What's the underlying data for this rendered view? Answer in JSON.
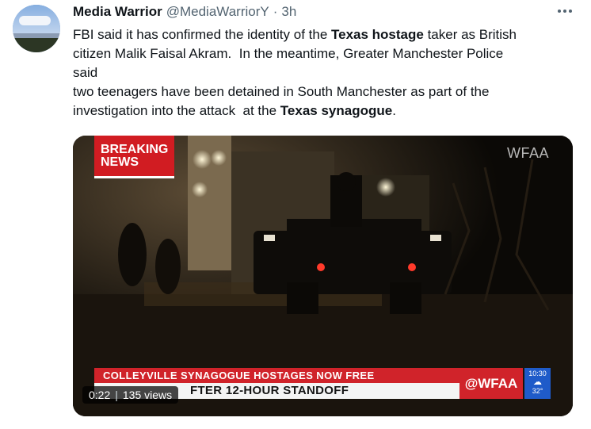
{
  "author": {
    "display_name": "Media Warrior",
    "handle": "@MediaWarriorY",
    "separator": "·",
    "timestamp": "3h"
  },
  "tweet": {
    "line1_a": "FBI said it has confirmed the identity of the ",
    "line1_bold": "Texas hostage",
    "line1_b": " taker as British",
    "line2": "citizen Malik Faisal Akram.  In the meantime, Greater Manchester Police",
    "line3": "said",
    "line4": "two teenagers have been detained in South Manchester as part of the",
    "line5_a": "investigation into the attack  at the ",
    "line5_bold": "Texas synagogue",
    "line5_b": "."
  },
  "video": {
    "breaking_line1": "BREAKING",
    "breaking_line2": "NEWS",
    "watermark": "WFAA",
    "ticker_headline": "COLLEYVILLE SYNAGOGUE HOSTAGES NOW FREE",
    "ticker_subline": "FTER 12-HOUR STANDOFF",
    "station_logo": "@WFAA",
    "weather_time": "10:30",
    "weather_temp": "32°",
    "current_time": "0:22",
    "view_count": "135 views"
  },
  "icons": {
    "more": "more-horizontal-icon",
    "avatar": "profile-avatar",
    "weather": "weather-cloud-icon"
  },
  "colors": {
    "text_primary": "#0f1419",
    "text_secondary": "#536471",
    "breaking_red": "#d11c22",
    "weather_blue": "#1f5bc9"
  }
}
